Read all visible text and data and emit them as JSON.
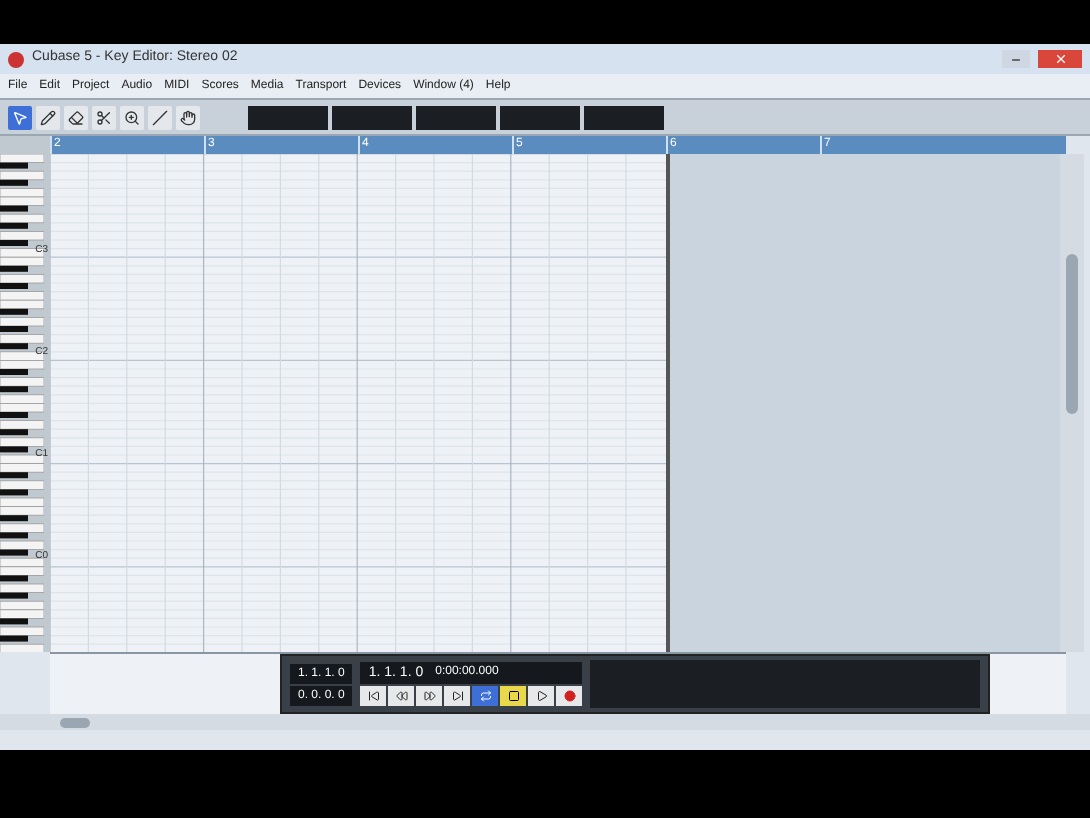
{
  "window": {
    "title": "Cubase 5 - Key Editor: Stereo 02"
  },
  "menu": [
    "File",
    "Edit",
    "Project",
    "Audio",
    "MIDI",
    "Scores",
    "Media",
    "Transport",
    "Devices",
    "Window (4)",
    "Help"
  ],
  "tools": [
    {
      "kind": "arrow",
      "selected": true
    },
    {
      "kind": "pencil",
      "selected": false
    },
    {
      "kind": "eraser",
      "selected": false
    },
    {
      "kind": "scissors",
      "selected": false
    },
    {
      "kind": "zoom",
      "selected": false
    },
    {
      "kind": "line",
      "selected": false
    },
    {
      "kind": "hand",
      "selected": false
    }
  ],
  "ruler": [
    "2",
    "3",
    "4",
    "5",
    "6",
    "7"
  ],
  "keyboard": {
    "octaves": [
      "C3",
      "C2",
      "C1",
      "C0"
    ]
  },
  "transport": {
    "position": "1. 1. 1. 0",
    "time": "0:00:00.000",
    "left_locator": "1. 1. 1. 0",
    "right_locator": "0. 0. 0. 0",
    "buttons": [
      {
        "kind": "start",
        "on": false
      },
      {
        "kind": "rewind",
        "on": false
      },
      {
        "kind": "forward",
        "on": false
      },
      {
        "kind": "end",
        "on": false
      },
      {
        "kind": "cycle",
        "on": true
      },
      {
        "kind": "stop",
        "on": true
      },
      {
        "kind": "play",
        "on": false
      },
      {
        "kind": "record",
        "on": false
      }
    ]
  }
}
